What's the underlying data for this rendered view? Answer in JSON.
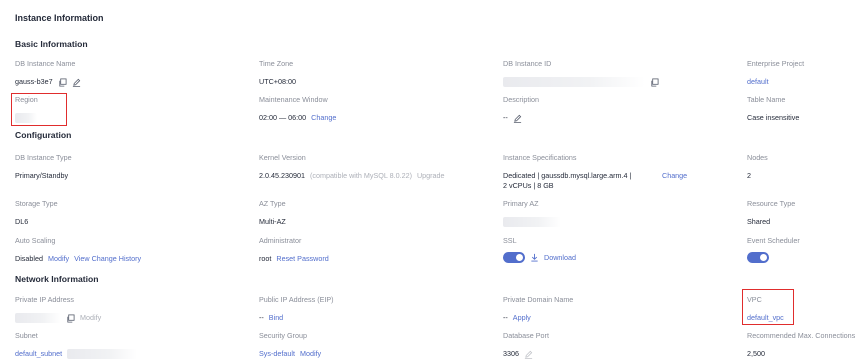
{
  "page_title": "Instance Information",
  "basic": {
    "title": "Basic Information",
    "db_instance_name": {
      "label": "DB Instance Name",
      "value": "gauss-b3e7"
    },
    "time_zone": {
      "label": "Time Zone",
      "value": "UTC+08:00"
    },
    "db_instance_id": {
      "label": "DB Instance ID"
    },
    "enterprise_project": {
      "label": "Enterprise Project",
      "value": "default"
    },
    "region": {
      "label": "Region"
    },
    "maintenance_window": {
      "label": "Maintenance Window",
      "value": "02:00 — 06:00",
      "action": "Change"
    },
    "description": {
      "label": "Description",
      "value": "--"
    },
    "table_name": {
      "label": "Table Name",
      "value": "Case insensitive"
    }
  },
  "configuration": {
    "title": "Configuration",
    "db_instance_type": {
      "label": "DB Instance Type",
      "value": "Primary/Standby"
    },
    "kernel_version": {
      "label": "Kernel Version",
      "value": "2.0.45.230901",
      "note": "(compatible with MySQL 8.0.22)",
      "action": "Upgrade"
    },
    "instance_specs": {
      "label": "Instance Specifications",
      "value": "Dedicated | gaussdb.mysql.large.arm.4 | 2 vCPUs | 8 GB",
      "action": "Change"
    },
    "nodes": {
      "label": "Nodes",
      "value": "2"
    },
    "storage_type": {
      "label": "Storage Type",
      "value": "DL6"
    },
    "az_type": {
      "label": "AZ Type",
      "value": "Multi-AZ"
    },
    "primary_az": {
      "label": "Primary AZ"
    },
    "resource_type": {
      "label": "Resource Type",
      "value": "Shared"
    },
    "auto_scaling": {
      "label": "Auto Scaling",
      "value": "Disabled",
      "modify": "Modify",
      "history": "View Change History"
    },
    "administrator": {
      "label": "Administrator",
      "value": "root",
      "action": "Reset Password"
    },
    "ssl": {
      "label": "SSL",
      "enabled": true,
      "action": "Download"
    },
    "event_scheduler": {
      "label": "Event Scheduler",
      "enabled": true
    }
  },
  "network": {
    "title": "Network Information",
    "private_ip": {
      "label": "Private IP Address",
      "action": "Modify"
    },
    "public_ip": {
      "label": "Public IP Address (EIP)",
      "value": "--",
      "action": "Bind"
    },
    "private_domain": {
      "label": "Private Domain Name",
      "value": "--",
      "action": "Apply"
    },
    "vpc": {
      "label": "VPC",
      "value": "default_vpc"
    },
    "subnet": {
      "label": "Subnet",
      "value": "default_subnet"
    },
    "security_group": {
      "label": "Security Group",
      "value": "Sys-default",
      "action": "Modify"
    },
    "database_port": {
      "label": "Database Port",
      "value": "3306"
    },
    "max_connections": {
      "label": "Recommended Max. Connections",
      "value": "2,500"
    }
  },
  "colors": {
    "link": "#526ecc",
    "highlight_box": "#e02d2d",
    "label": "#8a8e99",
    "text": "#252b3a"
  }
}
